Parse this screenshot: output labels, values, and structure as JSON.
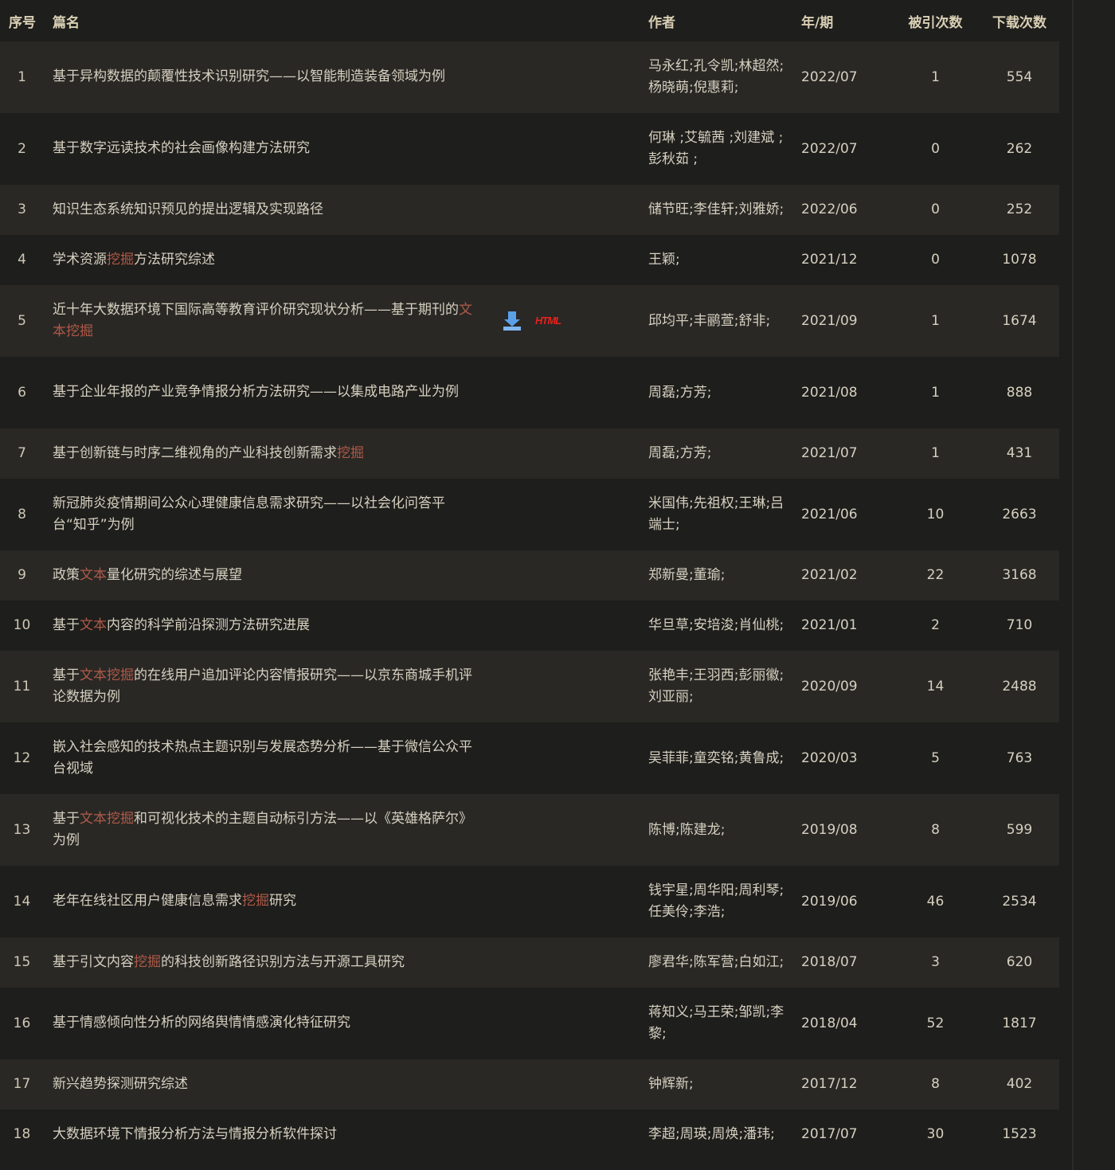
{
  "columns": {
    "no": "序号",
    "title": "篇名",
    "author": "作者",
    "issue": "年/期",
    "cited": "被引次数",
    "downloads": "下载次数"
  },
  "rows": [
    {
      "no": "1",
      "title": [
        {
          "t": "基于异构数据的颠覆性技术识别研究——以智能制造装备领域为例"
        }
      ],
      "author": "马永红;孔令凯;林超然;杨晓萌;倪惠莉;",
      "issue": "2022/07",
      "cited": "1",
      "downloads": "554"
    },
    {
      "no": "2",
      "title": [
        {
          "t": "基于数字远读技术的社会画像构建方法研究"
        }
      ],
      "author": "何琳 ;艾毓茜 ;刘建斌 ;彭秋茹 ;",
      "issue": "2022/07",
      "cited": "0",
      "downloads": "262"
    },
    {
      "no": "3",
      "title": [
        {
          "t": "知识生态系统知识预见的提出逻辑及实现路径"
        }
      ],
      "author": "储节旺;李佳轩;刘雅娇;",
      "issue": "2022/06",
      "cited": "0",
      "downloads": "252"
    },
    {
      "no": "4",
      "title": [
        {
          "t": "学术资源"
        },
        {
          "t": "挖掘",
          "h": true
        },
        {
          "t": "方法研究综述"
        }
      ],
      "author": "王颖;",
      "issue": "2021/12",
      "cited": "0",
      "downloads": "1078"
    },
    {
      "no": "5",
      "title": [
        {
          "t": "近十年大数据环境下国际高等教育评价研究现状分析——基于期刊的"
        },
        {
          "t": "文本挖掘",
          "h": true
        }
      ],
      "author": "邱均平;丰鹂萱;舒非;",
      "issue": "2021/09",
      "cited": "1",
      "downloads": "1674",
      "tools": {
        "download_icon": "download-icon",
        "html_label": "HTML"
      }
    },
    {
      "no": "6",
      "title": [
        {
          "t": "基于企业年报的产业竞争情报分析方法研究——以集成电路产业为例"
        }
      ],
      "author": "周磊;方芳;",
      "issue": "2021/08",
      "cited": "1",
      "downloads": "888"
    },
    {
      "no": "7",
      "title": [
        {
          "t": "基于创新链与时序二维视角的产业科技创新需求"
        },
        {
          "t": "挖掘",
          "h": true
        }
      ],
      "author": "周磊;方芳;",
      "issue": "2021/07",
      "cited": "1",
      "downloads": "431"
    },
    {
      "no": "8",
      "title": [
        {
          "t": "新冠肺炎疫情期间公众心理健康信息需求研究——以社会化问答平台“知乎”为例"
        }
      ],
      "author": "米国伟;先祖权;王琳;吕端士;",
      "issue": "2021/06",
      "cited": "10",
      "downloads": "2663"
    },
    {
      "no": "9",
      "title": [
        {
          "t": "政策"
        },
        {
          "t": "文本",
          "h": true
        },
        {
          "t": "量化研究的综述与展望"
        }
      ],
      "author": "郑新曼;董瑜;",
      "issue": "2021/02",
      "cited": "22",
      "downloads": "3168"
    },
    {
      "no": "10",
      "title": [
        {
          "t": "基于"
        },
        {
          "t": "文本",
          "h": true
        },
        {
          "t": "内容的科学前沿探测方法研究进展"
        }
      ],
      "author": "华旦草;安培浚;肖仙桃;",
      "issue": "2021/01",
      "cited": "2",
      "downloads": "710"
    },
    {
      "no": "11",
      "title": [
        {
          "t": "基于"
        },
        {
          "t": "文本挖掘",
          "h": true
        },
        {
          "t": "的在线用户追加评论内容情报研究——以京东商城手机评论数据为例"
        }
      ],
      "author": "张艳丰;王羽西;彭丽徽;刘亚丽;",
      "issue": "2020/09",
      "cited": "14",
      "downloads": "2488"
    },
    {
      "no": "12",
      "title": [
        {
          "t": "嵌入社会感知的技术热点主题识别与发展态势分析——基于微信公众平台视域"
        }
      ],
      "author": "吴菲菲;童奕铭;黄鲁成;",
      "issue": "2020/03",
      "cited": "5",
      "downloads": "763"
    },
    {
      "no": "13",
      "title": [
        {
          "t": "基于"
        },
        {
          "t": "文本挖掘",
          "h": true
        },
        {
          "t": "和可视化技术的主题自动标引方法——以《英雄格萨尔》为例"
        }
      ],
      "author": "陈博;陈建龙;",
      "issue": "2019/08",
      "cited": "8",
      "downloads": "599"
    },
    {
      "no": "14",
      "title": [
        {
          "t": "老年在线社区用户健康信息需求"
        },
        {
          "t": "挖掘",
          "h": true
        },
        {
          "t": "研究"
        }
      ],
      "author": "钱宇星;周华阳;周利琴;任美伶;李浩;",
      "issue": "2019/06",
      "cited": "46",
      "downloads": "2534"
    },
    {
      "no": "15",
      "title": [
        {
          "t": "基于引文内容"
        },
        {
          "t": "挖掘",
          "h": true
        },
        {
          "t": "的科技创新路径识别方法与开源工具研究"
        }
      ],
      "author": "廖君华;陈军营;白如江;",
      "issue": "2018/07",
      "cited": "3",
      "downloads": "620"
    },
    {
      "no": "16",
      "title": [
        {
          "t": "基于情感倾向性分析的网络舆情情感演化特征研究"
        }
      ],
      "author": "蒋知义;马王荣;邹凯;李黎;",
      "issue": "2018/04",
      "cited": "52",
      "downloads": "1817"
    },
    {
      "no": "17",
      "title": [
        {
          "t": "新兴趋势探测研究综述"
        }
      ],
      "author": "钟辉新;",
      "issue": "2017/12",
      "cited": "8",
      "downloads": "402"
    },
    {
      "no": "18",
      "title": [
        {
          "t": "大数据环境下情报分析方法与情报分析软件探讨"
        }
      ],
      "author": "李超;周瑛;周焕;潘玮;",
      "issue": "2017/07",
      "cited": "30",
      "downloads": "1523"
    }
  ],
  "colors": {
    "highlight": "#b05a48",
    "row_odd": "#292825",
    "row_even": "#1e1e1c",
    "html_red": "#e8211c"
  }
}
